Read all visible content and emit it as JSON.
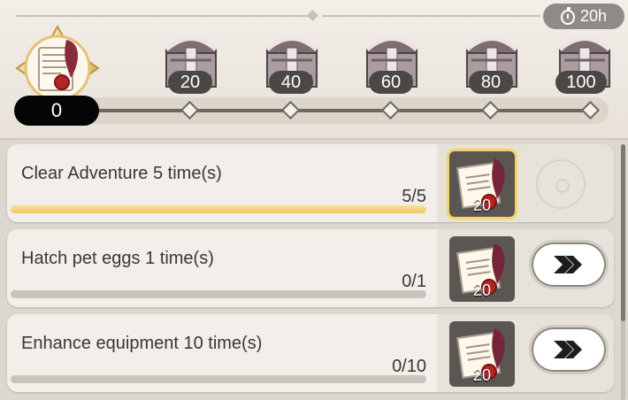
{
  "header": {
    "timer": "20h",
    "current_points": "0",
    "milestones": [
      "20",
      "40",
      "60",
      "80",
      "100"
    ]
  },
  "tasks": [
    {
      "title": "Clear Adventure 5 time(s)",
      "count": "5/5",
      "progress": 1,
      "reward": "20",
      "status": "claimed"
    },
    {
      "title": "Hatch pet eggs 1 time(s)",
      "count": "0/1",
      "progress": 0,
      "reward": "20",
      "status": "go"
    },
    {
      "title": "Enhance equipment 10 time(s)",
      "count": "0/10",
      "progress": 0,
      "reward": "20",
      "status": "go"
    }
  ],
  "colors": {
    "gold": "#f0c463",
    "dark": "#050505",
    "panel": "#f2efea"
  }
}
